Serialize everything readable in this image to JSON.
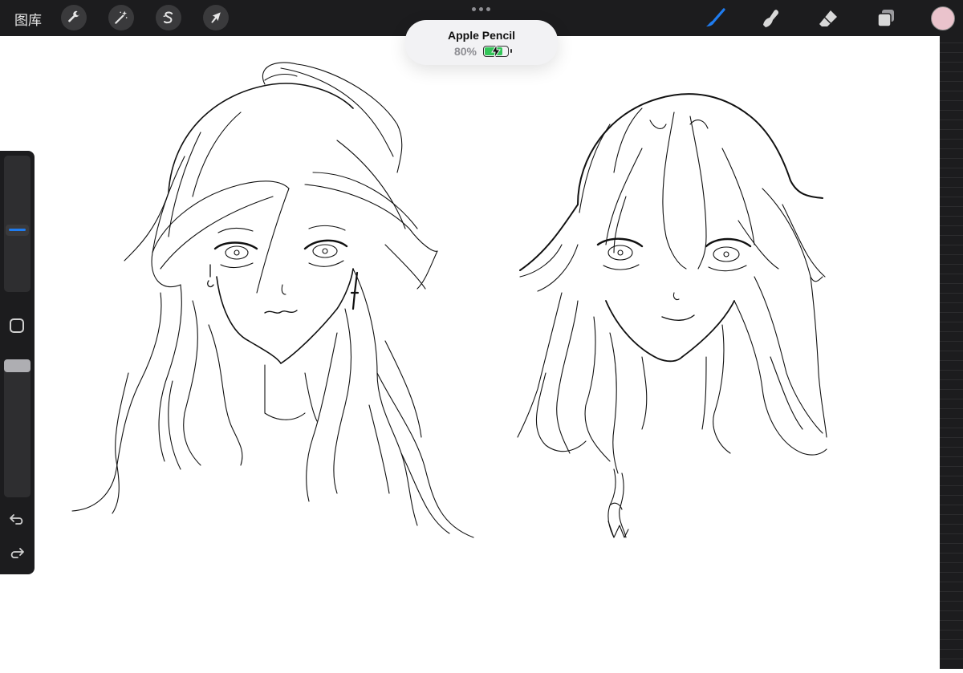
{
  "toolbar": {
    "gallery_label": "图库",
    "left_tools": [
      {
        "name": "actions",
        "icon": "wrench-icon"
      },
      {
        "name": "adjustments",
        "icon": "magic-wand-icon"
      },
      {
        "name": "selection",
        "icon": "selection-s-icon"
      },
      {
        "name": "transform",
        "icon": "arrow-cursor-icon"
      }
    ],
    "right_tools": [
      {
        "name": "brush",
        "icon": "brush-icon",
        "active": true
      },
      {
        "name": "smudge",
        "icon": "smudge-finger-icon"
      },
      {
        "name": "eraser",
        "icon": "eraser-icon"
      },
      {
        "name": "layers",
        "icon": "layers-icon"
      }
    ],
    "accent_color": "#1f7cf0",
    "current_color": "#eac3cc"
  },
  "pencil_popup": {
    "title": "Apple Pencil",
    "battery_percent": "80%",
    "battery_level": 0.8,
    "battery_color": "#33c659"
  },
  "sidebar": {
    "brush_size_level": 0.55,
    "opacity_level": 0.0,
    "modify_icon": "square-icon",
    "undo_icon": "undo-arrow-icon",
    "redo_icon": "redo-arrow-icon"
  },
  "canvas": {
    "subject": "line-art",
    "stroke_color": "#111111"
  }
}
